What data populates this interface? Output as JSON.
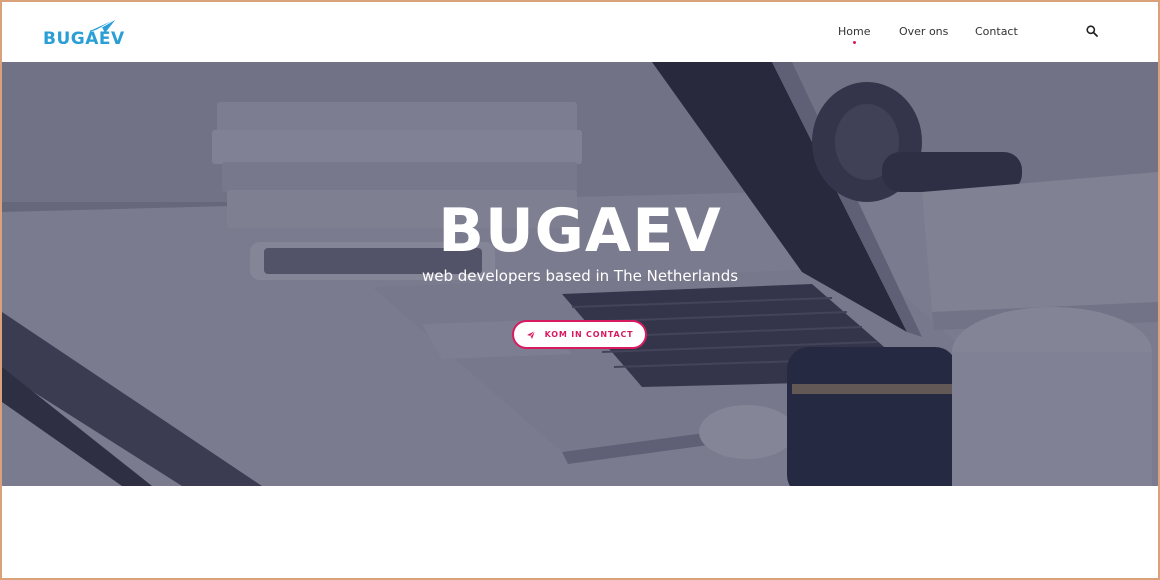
{
  "brand": {
    "logo_text": "BUGAEV",
    "logo_color": "#2a9fd6"
  },
  "nav": {
    "items": [
      {
        "label": "Home",
        "active": true
      },
      {
        "label": "Over ons",
        "active": false
      },
      {
        "label": "Contact",
        "active": false
      }
    ],
    "search_icon": "search-icon",
    "active_color": "#d81b60"
  },
  "hero": {
    "title": "BUGAEV",
    "subtitle": "web developers based in The Netherlands",
    "cta_label": "KOM IN CONTACT",
    "cta_icon": "paper-plane-icon",
    "accent": "#d81b60"
  }
}
